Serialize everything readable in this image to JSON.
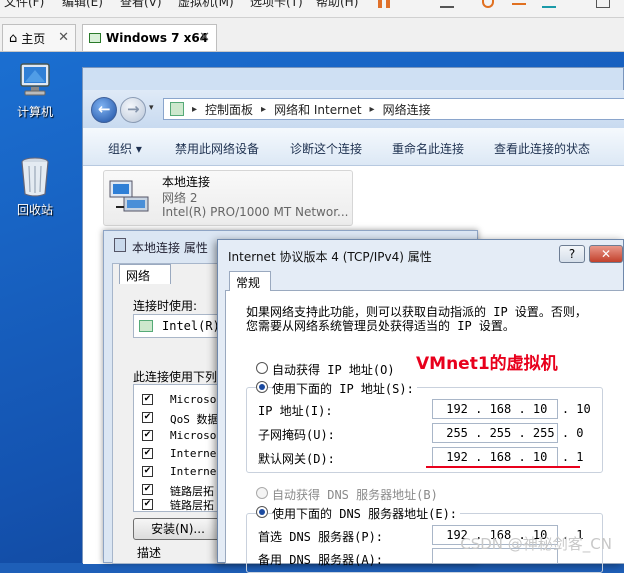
{
  "vm_menu": {
    "items": [
      "文件(F)",
      "编辑(E)",
      "查看(V)",
      "虚拟机(M)",
      "选项卡(T)",
      "帮助(H)"
    ]
  },
  "vm_tabs": [
    {
      "label": "主页"
    },
    {
      "label": "Windows 7 x64"
    }
  ],
  "desktop_icons": [
    {
      "label": "计算机"
    },
    {
      "label": "回收站"
    }
  ],
  "explorer": {
    "breadcrumb": [
      "控制面板",
      "网络和 Internet",
      "网络连接"
    ],
    "commands": [
      "组织 ▾",
      "禁用此网络设备",
      "诊断这个连接",
      "重命名此连接",
      "查看此连接的状态"
    ],
    "connection": {
      "name": "本地连接",
      "network": "网络  2",
      "adapter": "Intel(R) PRO/1000 MT Networ..."
    }
  },
  "props_dialog": {
    "title": "本地连接 属性",
    "tab": "网络",
    "connect_using_label": "连接时使用:",
    "adapter_short": "Intel(R)",
    "items_label": "此连接使用下列",
    "items": [
      "Microso",
      "QoS 数据",
      "Microso",
      "Interne",
      "Interne",
      "链路层拓",
      "链路层拓"
    ],
    "install_button": "安装(N)...",
    "description_label": "描述"
  },
  "tcp_dialog": {
    "title": "Internet 协议版本 4 (TCP/IPv4) 属性",
    "help_button": "?",
    "close_button": "✕",
    "tab": "常规",
    "intro_line1": "如果网络支持此功能，则可以获取自动指派的 IP 设置。否则，",
    "intro_line2": "您需要从网络系统管理员处获得适当的 IP 设置。",
    "annotation": "VMnet1的虚拟机",
    "auto_ip": "自动获得 IP 地址(O)",
    "manual_ip": "使用下面的 IP 地址(S):",
    "ip_label": "IP 地址(I):",
    "ip_value": " 192 . 168 . 10  . 10",
    "mask_label": "子网掩码(U):",
    "mask_value": " 255 . 255 . 255 . 0",
    "gateway_label": "默认网关(D):",
    "gateway_value": " 192 . 168 . 10  . 1",
    "auto_dns": "自动获得 DNS 服务器地址(B)",
    "manual_dns": "使用下面的 DNS 服务器地址(E):",
    "dns1_label": "首选 DNS 服务器(P):",
    "dns1_value": " 192 . 168 . 10  . 1",
    "dns2_label": "备用 DNS 服务器(A):"
  },
  "watermark": "CSDN @神秘剑客_CN",
  "colors": {
    "annotation": "#e8001c",
    "underline": "#e8001c",
    "window_accent": "#1e5fb8"
  }
}
